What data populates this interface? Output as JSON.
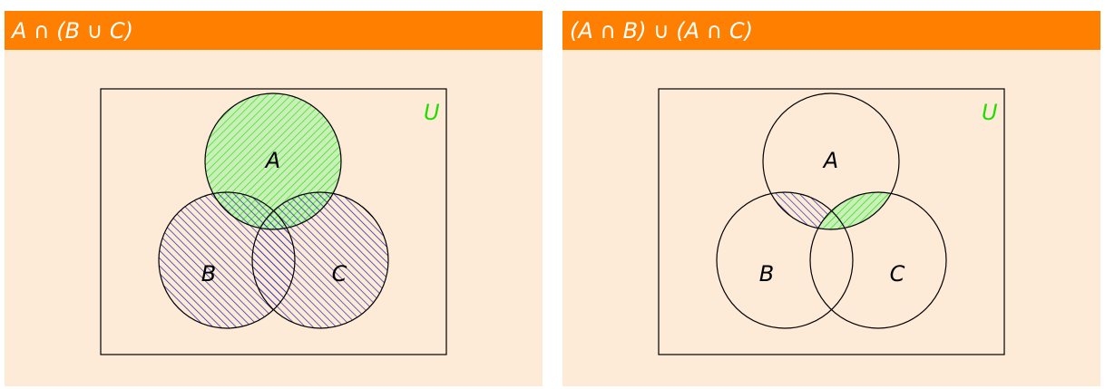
{
  "colors": {
    "header": "#ff8000",
    "panel_background": "#fdebd8",
    "title_text": "#ffffff",
    "universe_label": "#22dd00",
    "hatch_green": "#33dd11",
    "hatch_blue": "#2222aa",
    "outline": "#000000"
  },
  "hatch": {
    "green_direction": "down-right diagonal",
    "blue_direction": "up-right diagonal"
  },
  "left": {
    "title": "A ∩ (B ∪ C)",
    "universe_label": "U",
    "labels": {
      "a": "A",
      "b": "B",
      "c": "C"
    },
    "hatched": {
      "a": "green",
      "b_or_c": "blue"
    }
  },
  "right": {
    "title": "(A ∩ B) ∪ (A ∩ C)",
    "universe_label": "U",
    "labels": {
      "a": "A",
      "b": "B",
      "c": "C"
    },
    "hatched": {
      "a_and_b": "blue",
      "a_and_c": "green"
    }
  }
}
